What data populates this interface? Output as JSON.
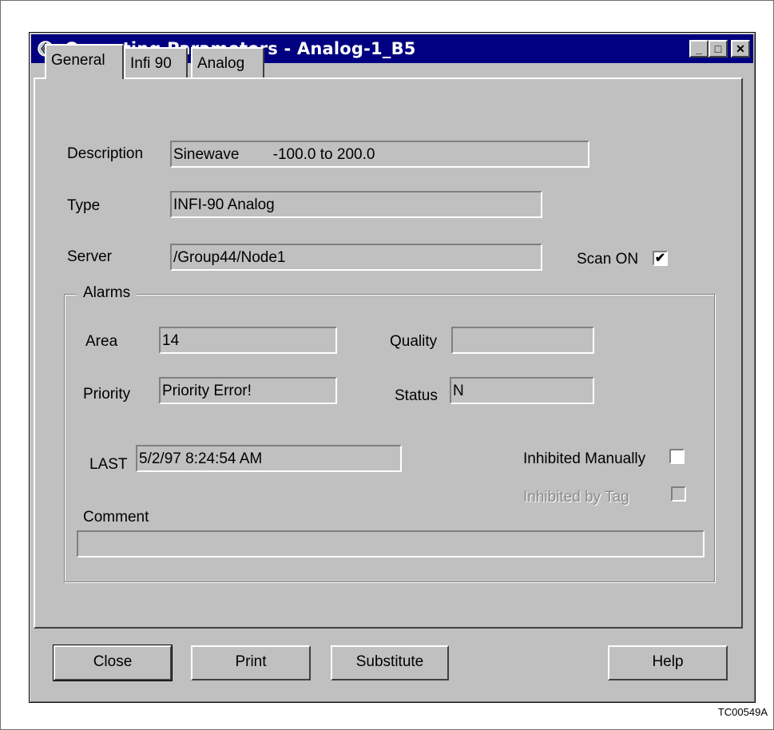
{
  "window": {
    "title": "Operating Parameters - Analog-1_B5",
    "app_icon": "app-icon",
    "controls": {
      "minimize": "_",
      "maximize": "□",
      "close": "✕"
    }
  },
  "tabs": [
    {
      "label": "General",
      "active": true
    },
    {
      "label": "Infi 90",
      "active": false
    },
    {
      "label": "Analog",
      "active": false
    }
  ],
  "general": {
    "description_label": "Description",
    "description_value": "Sinewave        -100.0 to 200.0",
    "type_label": "Type",
    "type_value": "INFI-90 Analog",
    "server_label": "Server",
    "server_value": "/Group44/Node1",
    "scan_on_label": "Scan ON",
    "scan_on_checked": true
  },
  "alarms": {
    "legend": "Alarms",
    "area_label": "Area",
    "area_value": "14",
    "quality_label": "Quality",
    "quality_value": "",
    "priority_label": "Priority",
    "priority_value": "Priority Error!",
    "status_label": "Status",
    "status_value": "N",
    "last_label": "LAST",
    "last_value": "5/2/97 8:24:54 AM",
    "inhibited_manually_label": "Inhibited Manually",
    "inhibited_manually_checked": false,
    "inhibited_by_tag_label": "Inhibited by Tag",
    "inhibited_by_tag_checked": false,
    "comment_label": "Comment",
    "comment_value": ""
  },
  "buttons": {
    "close": "Close",
    "print": "Print",
    "substitute": "Substitute",
    "help": "Help"
  },
  "figure_id": "TC00549A",
  "colors": {
    "titlebar": "#000080",
    "face": "#c0c0c0"
  }
}
